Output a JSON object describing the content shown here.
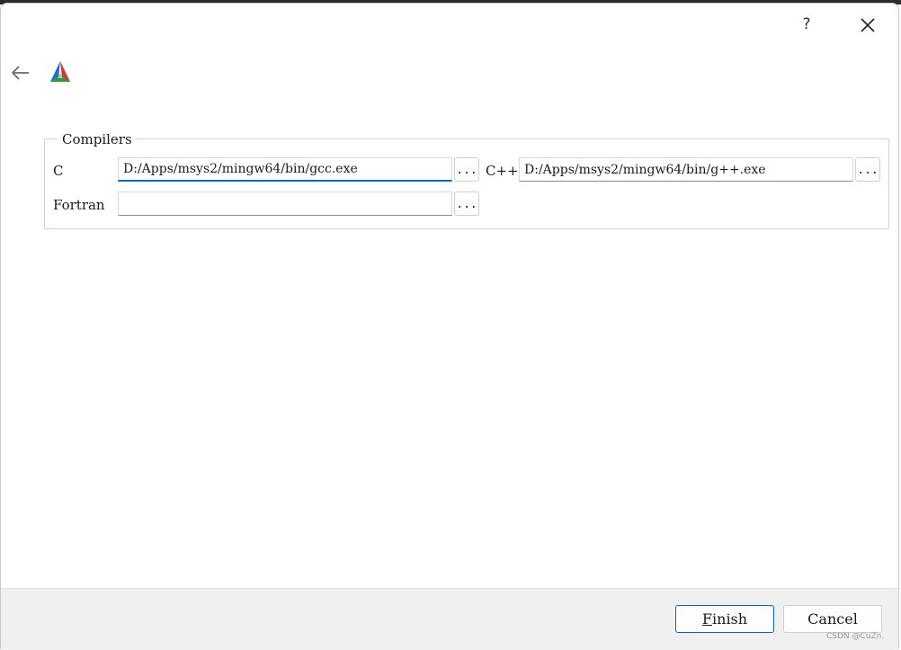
{
  "title_bar": {
    "help_label": "?",
    "help_icon": "question-mark-icon",
    "close_icon": "close-icon"
  },
  "header": {
    "back_icon": "arrow-left-icon",
    "logo_icon": "cmake-logo-icon"
  },
  "compilers": {
    "group_title": "Compilers",
    "c": {
      "label": "C",
      "value": "D:/Apps/msys2/mingw64/bin/gcc.exe",
      "browse_label": "..."
    },
    "cpp": {
      "label": "C++",
      "value": "D:/Apps/msys2/mingw64/bin/g++.exe",
      "browse_label": "..."
    },
    "fortran": {
      "label": "Fortran",
      "value": "",
      "browse_label": "..."
    }
  },
  "footer": {
    "finish_underline": "F",
    "finish_rest": "inish",
    "cancel_label": "Cancel"
  },
  "watermark": "CSDN @CuZn."
}
